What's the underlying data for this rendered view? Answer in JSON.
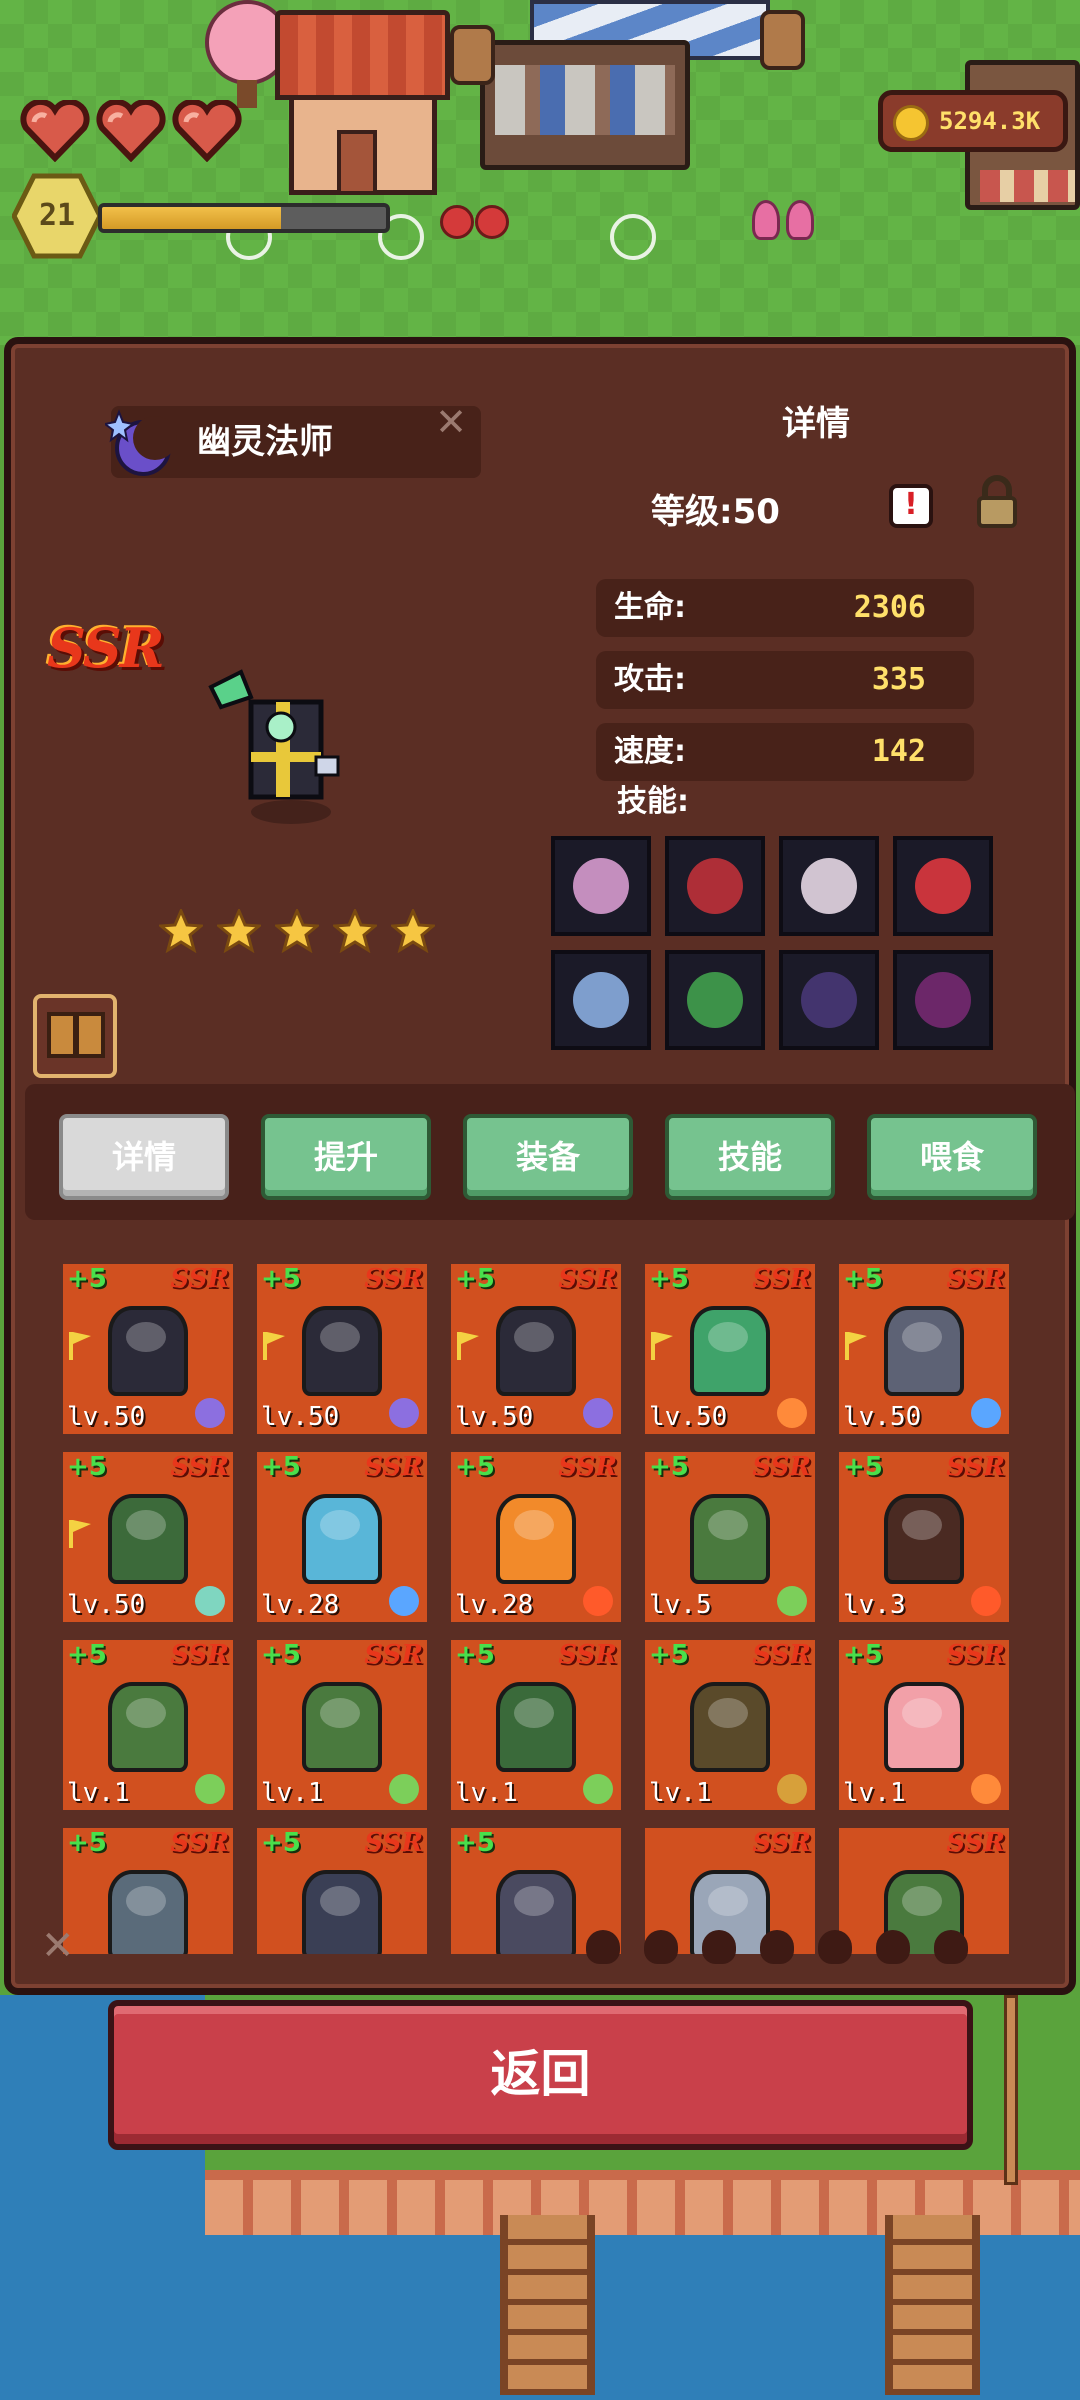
{
  "hud": {
    "hearts": 3,
    "player_level": "21",
    "xp_progress": 0.63,
    "coins": "5294.3K"
  },
  "hero": {
    "name": "幽灵法师",
    "rarity": "SSR",
    "stars": 5,
    "detail_title": "详情",
    "level_text": "等级:50",
    "alert_symbol": "!",
    "stats": [
      {
        "label": "生命:",
        "value": "2306"
      },
      {
        "label": "攻击:",
        "value": "335"
      },
      {
        "label": "速度:",
        "value": "142"
      }
    ],
    "skills_label": "技能:",
    "skills": [
      {
        "icon": "skull-icon",
        "color": "#e2a3d8"
      },
      {
        "icon": "crosshair-icon",
        "color": "#c8323a"
      },
      {
        "icon": "eye-icon",
        "color": "#f1e3ee"
      },
      {
        "icon": "sword-slash-icon",
        "color": "#e8393f"
      },
      {
        "icon": "feather-icon",
        "color": "#8fb6ea"
      },
      {
        "icon": "spirit-flame-icon",
        "color": "#43a84f"
      },
      {
        "icon": "bat-demon-icon",
        "color": "#4a3a7a"
      },
      {
        "icon": "shadow-portal-icon",
        "color": "#7a2a74"
      }
    ]
  },
  "tabs": [
    {
      "label": "详情",
      "active": true
    },
    {
      "label": "提升",
      "active": false
    },
    {
      "label": "装备",
      "active": false
    },
    {
      "label": "技能",
      "active": false
    },
    {
      "label": "喂食",
      "active": false
    }
  ],
  "hero_cards": [
    {
      "plus": "+5",
      "rarity": "SSR",
      "level": "lv.50",
      "flag": true,
      "element": "moon",
      "color": "#2b2a38"
    },
    {
      "plus": "+5",
      "rarity": "SSR",
      "level": "lv.50",
      "flag": true,
      "element": "moon",
      "color": "#2b2a38"
    },
    {
      "plus": "+5",
      "rarity": "SSR",
      "level": "lv.50",
      "flag": true,
      "element": "moon",
      "color": "#2b2a38"
    },
    {
      "plus": "+5",
      "rarity": "SSR",
      "level": "lv.50",
      "flag": true,
      "element": "sun",
      "color": "#3fa36a"
    },
    {
      "plus": "+5",
      "rarity": "SSR",
      "level": "lv.50",
      "flag": true,
      "element": "water",
      "color": "#5d6275"
    },
    {
      "plus": "+5",
      "rarity": "SSR",
      "level": "lv.50",
      "flag": true,
      "element": "wind",
      "color": "#3c6a3a"
    },
    {
      "plus": "+5",
      "rarity": "SSR",
      "level": "lv.28",
      "flag": false,
      "element": "water",
      "color": "#59b6d8"
    },
    {
      "plus": "+5",
      "rarity": "SSR",
      "level": "lv.28",
      "flag": false,
      "element": "fire",
      "color": "#f28a2a"
    },
    {
      "plus": "+5",
      "rarity": "SSR",
      "level": "lv.5",
      "flag": false,
      "element": "leaf",
      "color": "#4a7a3e"
    },
    {
      "plus": "+5",
      "rarity": "SSR",
      "level": "lv.3",
      "flag": false,
      "element": "fire",
      "color": "#4a2a22"
    },
    {
      "plus": "+5",
      "rarity": "SSR",
      "level": "lv.1",
      "flag": false,
      "element": "leaf",
      "color": "#4a7a3e"
    },
    {
      "plus": "+5",
      "rarity": "SSR",
      "level": "lv.1",
      "flag": false,
      "element": "leaf",
      "color": "#4a7a3e"
    },
    {
      "plus": "+5",
      "rarity": "SSR",
      "level": "lv.1",
      "flag": false,
      "element": "leaf",
      "color": "#3a6a3a"
    },
    {
      "plus": "+5",
      "rarity": "SSR",
      "level": "lv.1",
      "flag": false,
      "element": "earth",
      "color": "#5a4a2a"
    },
    {
      "plus": "+5",
      "rarity": "SSR",
      "level": "lv.1",
      "flag": false,
      "element": "sun",
      "color": "#f2a0a8"
    },
    {
      "plus": "+5",
      "rarity": "SSR",
      "level": "",
      "flag": false,
      "element": "",
      "color": "#5a6b7a"
    },
    {
      "plus": "+5",
      "rarity": "SSR",
      "level": "",
      "flag": false,
      "element": "",
      "color": "#3a3f55"
    },
    {
      "plus": "+5",
      "rarity": "",
      "level": "",
      "flag": false,
      "element": "",
      "color": "#4a4a60"
    },
    {
      "plus": "",
      "rarity": "SSR",
      "level": "",
      "flag": false,
      "element": "",
      "color": "#9aa6b8"
    },
    {
      "plus": "",
      "rarity": "SSR",
      "level": "",
      "flag": false,
      "element": "",
      "color": "#4a7a3e"
    }
  ],
  "element_filters": [
    "fire-filter-icon",
    "earth-filter-icon",
    "water-filter-icon",
    "wind-filter-icon",
    "flame-filter-icon",
    "leaf-filter-icon",
    "moon-filter-icon"
  ],
  "element_colors": {
    "moon": "#8c6fe0",
    "sun": "#ff8a3a",
    "water": "#5aa6ff",
    "wind": "#7fd6c0",
    "fire": "#ff5a2a",
    "leaf": "#7ccf5a",
    "earth": "#d7a03a"
  },
  "return_label": "返回"
}
